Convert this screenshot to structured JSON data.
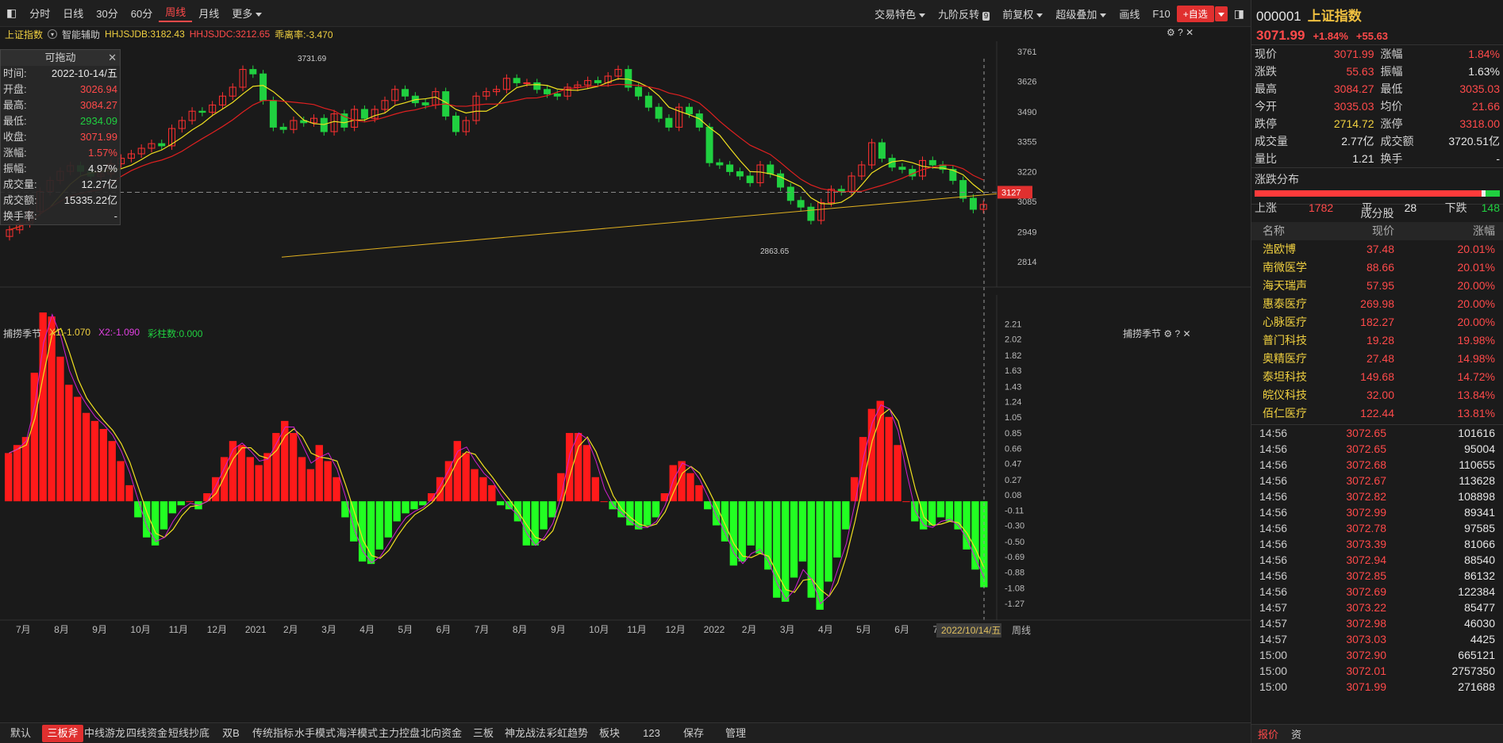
{
  "topbar": {
    "left_items": [
      "分时",
      "日线",
      "30分",
      "60分",
      "周线",
      "月线",
      "更多"
    ],
    "active": "周线",
    "right_items": [
      "交易特色",
      "九阶反转",
      "前复权",
      "超级叠加",
      "画线",
      "F10"
    ],
    "add_button": "+自选"
  },
  "subbar": {
    "index_name": "上证指数",
    "assist": "智能辅助",
    "hhsjdb": "HHJSJDB:3182.43",
    "hhsjdc": "HHJSJDC:3212.65",
    "deviation": "乖离率:-3.470"
  },
  "indicator_bar": {
    "name": "捕捞季节",
    "x1": "X1:-1.070",
    "x2": "X2:-1.090",
    "bars": "彩柱数:0.000"
  },
  "info_panel": {
    "title": "可拖动",
    "rows": [
      {
        "label": "时间:",
        "value": "2022-10-14/五",
        "color": "white"
      },
      {
        "label": "开盘:",
        "value": "3026.94",
        "color": "red"
      },
      {
        "label": "最高:",
        "value": "3084.27",
        "color": "red"
      },
      {
        "label": "最低:",
        "value": "2934.09",
        "color": "green"
      },
      {
        "label": "收盘:",
        "value": "3071.99",
        "color": "red"
      },
      {
        "label": "涨幅:",
        "value": "1.57%",
        "color": "red"
      },
      {
        "label": "振幅:",
        "value": "4.97%",
        "color": "white"
      },
      {
        "label": "成交量:",
        "value": "12.27亿",
        "color": "white"
      },
      {
        "label": "成交额:",
        "value": "15335.22亿",
        "color": "white"
      },
      {
        "label": "换手率:",
        "value": "-",
        "color": "white"
      }
    ]
  },
  "chart_data": [
    {
      "type": "candlestick",
      "title": "上证指数 周线",
      "y_ticks": [
        3761,
        3626,
        3490,
        3355,
        3220,
        3085,
        2949,
        2814
      ],
      "ylim": [
        2800,
        3800
      ],
      "annotations": {
        "high": "3731.69",
        "low": "2863.65",
        "current": "3127"
      },
      "x_labels": [
        "7月",
        "8月",
        "9月",
        "10月",
        "11月",
        "12月",
        "2021",
        "2月",
        "3月",
        "4月",
        "5月",
        "6月",
        "7月",
        "8月",
        "9月",
        "10月",
        "11月",
        "12月",
        "2022",
        "2月",
        "3月",
        "4月",
        "5月",
        "6月",
        "7月",
        "8月"
      ],
      "closes": [
        2958,
        2986,
        3040,
        3130,
        3180,
        3221,
        3247,
        3221,
        3199,
        3210,
        3255,
        3280,
        3300,
        3325,
        3346,
        3336,
        3414,
        3450,
        3492,
        3487,
        3520,
        3560,
        3600,
        3680,
        3660,
        3540,
        3420,
        3410,
        3450,
        3440,
        3460,
        3400,
        3480,
        3420,
        3500,
        3460,
        3500,
        3540,
        3590,
        3560,
        3530,
        3520,
        3580,
        3470,
        3400,
        3450,
        3560,
        3580,
        3590,
        3640,
        3620,
        3620,
        3590,
        3570,
        3560,
        3600,
        3610,
        3630,
        3620,
        3650,
        3680,
        3600,
        3560,
        3510,
        3460,
        3420,
        3510,
        3480,
        3420,
        3260,
        3250,
        3220,
        3200,
        3170,
        3250,
        3210,
        3150,
        3090,
        3060,
        3000,
        3080,
        3140,
        3130,
        3200,
        3250,
        3350,
        3280,
        3240,
        3230,
        3200,
        3270,
        3250,
        3230,
        3180,
        3100,
        3050,
        3071.99
      ]
    },
    {
      "type": "bar",
      "title": "捕捞季节",
      "y_ticks": [
        2.21,
        2.02,
        1.82,
        1.63,
        1.43,
        1.24,
        1.05,
        0.85,
        0.66,
        0.47,
        0.27,
        0.08,
        -0.11,
        -0.3,
        -0.5,
        -0.69,
        -0.88,
        -1.08,
        -1.27
      ],
      "ylim": [
        -1.4,
        2.4
      ],
      "values": [
        0.6,
        0.7,
        0.8,
        1.6,
        2.35,
        2.3,
        1.8,
        1.45,
        1.3,
        1.1,
        1.0,
        0.9,
        0.75,
        0.5,
        0.2,
        -0.2,
        -0.45,
        -0.55,
        -0.35,
        -0.15,
        -0.05,
        0.0,
        -0.1,
        0.1,
        0.3,
        0.55,
        0.75,
        0.7,
        0.55,
        0.45,
        0.6,
        0.85,
        1.0,
        0.85,
        0.55,
        0.4,
        0.7,
        0.5,
        0.3,
        -0.2,
        -0.5,
        -0.75,
        -0.78,
        -0.6,
        -0.45,
        -0.25,
        -0.15,
        -0.1,
        -0.05,
        0.1,
        0.3,
        0.5,
        0.75,
        0.6,
        0.4,
        0.3,
        0.2,
        -0.05,
        -0.1,
        -0.25,
        -0.55,
        -0.55,
        -0.35,
        -0.2,
        0.35,
        0.85,
        0.85,
        0.7,
        0.3,
        0.0,
        -0.1,
        -0.2,
        -0.3,
        -0.35,
        -0.3,
        -0.2,
        0.1,
        0.45,
        0.5,
        0.35,
        0.2,
        -0.1,
        -0.3,
        -0.5,
        -0.8,
        -0.75,
        -0.55,
        -0.65,
        -0.85,
        -1.2,
        -1.25,
        -0.95,
        -0.75,
        -1.2,
        -1.35,
        -1.0,
        -0.7,
        -0.35,
        0.3,
        0.8,
        1.15,
        1.25,
        1.05,
        0.7,
        0.0,
        -0.25,
        -0.35,
        -0.3,
        -0.2,
        -0.25,
        -0.35,
        -0.6,
        -0.85,
        -1.07
      ]
    }
  ],
  "bottombar": {
    "tabs": [
      "默认",
      "三板斧",
      "中线游龙",
      "四线资金",
      "短线抄底",
      "双B",
      "传统指标",
      "水手模式",
      "海洋模式",
      "主力控盘",
      "北向资金",
      "三板",
      "神龙战法",
      "彩虹趋势",
      "板块",
      "123",
      "保存",
      "管理"
    ],
    "active": "三板斧",
    "date_label": "2022/10/14/五",
    "period": "周线"
  },
  "right_panel": {
    "code": "000001",
    "name": "上证指数",
    "price": "3071.99",
    "change_pct": "+1.84%",
    "change": "+55.63",
    "quote": [
      [
        {
          "l": "现价",
          "v": "3071.99",
          "c": "red"
        },
        {
          "l": "涨幅",
          "v": "1.84%",
          "c": "red"
        }
      ],
      [
        {
          "l": "涨跌",
          "v": "55.63",
          "c": "red"
        },
        {
          "l": "振幅",
          "v": "1.63%",
          "c": "white"
        }
      ],
      [
        {
          "l": "最高",
          "v": "3084.27",
          "c": "red"
        },
        {
          "l": "最低",
          "v": "3035.03",
          "c": "red"
        }
      ],
      [
        {
          "l": "今开",
          "v": "3035.03",
          "c": "red"
        },
        {
          "l": "均价",
          "v": "21.66",
          "c": "red"
        }
      ],
      [
        {
          "l": "跌停",
          "v": "2714.72",
          "c": "yellow"
        },
        {
          "l": "涨停",
          "v": "3318.00",
          "c": "red"
        }
      ],
      [
        {
          "l": "成交量",
          "v": "2.77亿",
          "c": "white"
        },
        {
          "l": "成交额",
          "v": "3720.51亿",
          "c": "white"
        }
      ],
      [
        {
          "l": "量比",
          "v": "1.21",
          "c": "white"
        },
        {
          "l": "换手",
          "v": "-",
          "c": "white"
        }
      ]
    ],
    "distribution": {
      "title": "涨跌分布",
      "up_label": "上涨",
      "up": "1782",
      "flat_label": "平",
      "flat": "28",
      "down_label": "下跌",
      "down": "148"
    },
    "constituents_title": "成分股",
    "constituents_head": [
      "名称",
      "现价",
      "涨幅"
    ],
    "constituents": [
      {
        "n": "浩欧博",
        "p": "37.48",
        "r": "20.01%"
      },
      {
        "n": "南微医学",
        "p": "88.66",
        "r": "20.01%"
      },
      {
        "n": "海天瑞声",
        "p": "57.95",
        "r": "20.00%"
      },
      {
        "n": "惠泰医疗",
        "p": "269.98",
        "r": "20.00%"
      },
      {
        "n": "心脉医疗",
        "p": "182.27",
        "r": "20.00%"
      },
      {
        "n": "普门科技",
        "p": "19.28",
        "r": "19.98%"
      },
      {
        "n": "奥精医疗",
        "p": "27.48",
        "r": "14.98%"
      },
      {
        "n": "泰坦科技",
        "p": "149.68",
        "r": "14.72%"
      },
      {
        "n": "皖仪科技",
        "p": "32.00",
        "r": "13.84%"
      },
      {
        "n": "佰仁医疗",
        "p": "122.44",
        "r": "13.81%"
      }
    ],
    "ticks": [
      {
        "t": "14:56",
        "p": "3072.65",
        "v": "101616"
      },
      {
        "t": "14:56",
        "p": "3072.65",
        "v": "95004"
      },
      {
        "t": "14:56",
        "p": "3072.68",
        "v": "110655"
      },
      {
        "t": "14:56",
        "p": "3072.67",
        "v": "113628"
      },
      {
        "t": "14:56",
        "p": "3072.82",
        "v": "108898"
      },
      {
        "t": "14:56",
        "p": "3072.99",
        "v": "89341"
      },
      {
        "t": "14:56",
        "p": "3072.78",
        "v": "97585"
      },
      {
        "t": "14:56",
        "p": "3073.39",
        "v": "81066"
      },
      {
        "t": "14:56",
        "p": "3072.94",
        "v": "88540"
      },
      {
        "t": "14:56",
        "p": "3072.85",
        "v": "86132"
      },
      {
        "t": "14:56",
        "p": "3072.69",
        "v": "122384"
      },
      {
        "t": "14:57",
        "p": "3073.22",
        "v": "85477"
      },
      {
        "t": "14:57",
        "p": "3072.98",
        "v": "46030"
      },
      {
        "t": "14:57",
        "p": "3073.03",
        "v": "4425"
      },
      {
        "t": "15:00",
        "p": "3072.90",
        "v": "665121"
      },
      {
        "t": "15:00",
        "p": "3072.01",
        "v": "2757350"
      },
      {
        "t": "15:00",
        "p": "3071.99",
        "v": "271688"
      }
    ],
    "bottom_tabs": [
      "报价",
      "资"
    ]
  }
}
